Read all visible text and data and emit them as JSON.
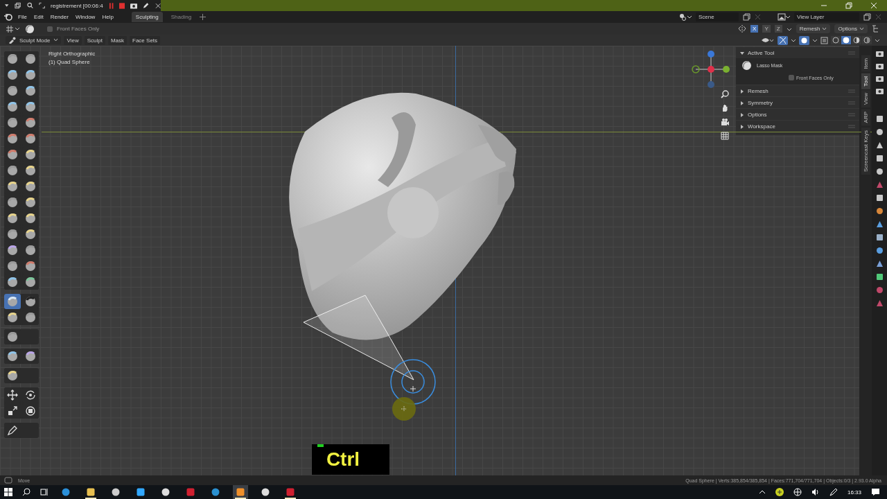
{
  "recorder_bar": {
    "title": "registrement [00:06:4"
  },
  "menu_bar": {
    "items": [
      "File",
      "Edit",
      "Render",
      "Window",
      "Help"
    ],
    "workspace_tabs": [
      {
        "label": "Sculpting",
        "selected": true
      },
      {
        "label": "Shading",
        "selected": false
      }
    ],
    "scene": "Scene",
    "view_layer": "View Layer"
  },
  "tool_header": {
    "front_faces_only": {
      "label": "Front Faces Only",
      "checked": false
    },
    "symmetry_axes": [
      {
        "label": "X",
        "selected": true
      },
      {
        "label": "Y",
        "selected": false
      },
      {
        "label": "Z",
        "selected": false
      }
    ],
    "dropdowns": [
      "Remesh",
      "Options"
    ]
  },
  "viewport_header": {
    "mode": "Sculpt Mode",
    "menus": [
      "View",
      "Sculpt",
      "Mask",
      "Face Sets"
    ],
    "shading_modes": [
      {
        "selected": false
      },
      {
        "selected": true
      },
      {
        "selected": false
      },
      {
        "selected": false
      }
    ]
  },
  "viewport": {
    "view_name": "Right Orthographic",
    "object_name": "(1) Quad Sphere",
    "key_overlay": "Ctrl"
  },
  "toolbar": {
    "groups": [
      {
        "tools": [
          {
            "selected": false
          },
          {
            "selected": false
          },
          {
            "selected": false
          },
          {
            "selected": false
          },
          {
            "selected": false
          },
          {
            "selected": false
          },
          {
            "selected": false
          },
          {
            "selected": false
          },
          {
            "selected": false
          },
          {
            "selected": false
          },
          {
            "selected": false
          },
          {
            "selected": false
          },
          {
            "selected": false
          },
          {
            "selected": false
          },
          {
            "selected": false
          },
          {
            "selected": false
          },
          {
            "selected": false
          },
          {
            "selected": false
          },
          {
            "selected": false
          },
          {
            "selected": false
          },
          {
            "selected": false
          },
          {
            "selected": false
          },
          {
            "selected": false
          },
          {
            "selected": false
          },
          {
            "selected": false
          },
          {
            "selected": false
          },
          {
            "selected": false
          },
          {
            "selected": false
          },
          {
            "selected": false
          },
          {
            "selected": false
          }
        ]
      },
      {
        "tools": [
          {
            "selected": true
          },
          {
            "selected": false
          },
          {
            "selected": false
          },
          {
            "selected": false
          }
        ]
      },
      {
        "tools": [
          {
            "selected": false
          }
        ]
      },
      {
        "tools": [
          {
            "selected": false
          },
          {
            "selected": false
          }
        ]
      },
      {
        "tools": [
          {
            "selected": false
          }
        ]
      },
      {
        "tools": [
          {
            "selected": false
          },
          {
            "selected": false
          },
          {
            "selected": false
          },
          {
            "selected": false
          }
        ]
      },
      {
        "tools": [
          {
            "selected": false
          }
        ]
      }
    ]
  },
  "sidebar": {
    "panels": [
      {
        "title": "Active Tool",
        "expanded": true
      },
      {
        "title": "Remesh",
        "expanded": false
      },
      {
        "title": "Symmetry",
        "expanded": false
      },
      {
        "title": "Options",
        "expanded": false
      },
      {
        "title": "Workspace",
        "expanded": false
      }
    ],
    "active_tool": "Lasso Mask",
    "front_faces_only": {
      "label": "Front Faces Only",
      "checked": false
    },
    "tabs": [
      {
        "label": "Item",
        "selected": false
      },
      {
        "label": "Tool",
        "selected": true
      },
      {
        "label": "View",
        "selected": false
      },
      {
        "label": "ARP",
        "selected": false
      },
      {
        "label": "Screencast Keys",
        "selected": false
      }
    ]
  },
  "status_bar": {
    "hint": "Move",
    "stats": "Quad Sphere | Verts:385,854/385,854 | Faces:771,704/771,704 | Objects:0/3 | 2.93.0 Alpha"
  },
  "taskbar": {
    "apps": [
      {
        "selected": false,
        "running": false
      },
      {
        "selected": false,
        "running": true
      },
      {
        "selected": false,
        "running": false
      },
      {
        "selected": false,
        "running": false
      },
      {
        "selected": false,
        "running": false
      },
      {
        "selected": false,
        "running": false
      },
      {
        "selected": false,
        "running": false
      },
      {
        "selected": true,
        "running": true
      },
      {
        "selected": false,
        "running": false
      },
      {
        "selected": false,
        "running": true
      }
    ],
    "clock": "16:33"
  }
}
